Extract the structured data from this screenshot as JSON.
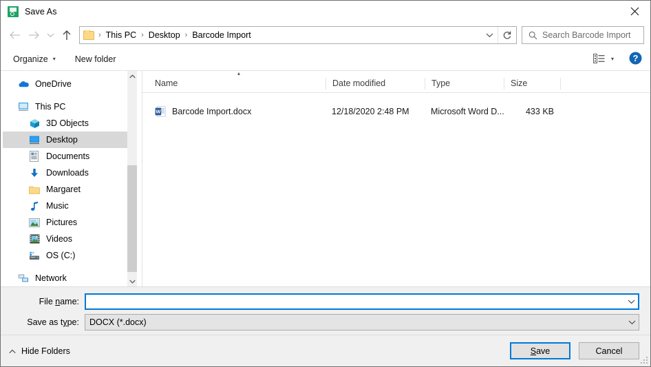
{
  "window": {
    "title": "Save As",
    "icon": "save-green-icon",
    "close_label": "✕"
  },
  "nav": {
    "back_icon": "back-arrow-icon",
    "forward_icon": "forward-arrow-icon",
    "recent_icon": "recent-locations-chevron-icon",
    "up_icon": "up-arrow-icon",
    "breadcrumbs": [
      "This PC",
      "Desktop",
      "Barcode Import"
    ],
    "separator": "›",
    "dropdown_icon": "chevron-down-icon",
    "refresh_icon": "refresh-icon"
  },
  "search": {
    "placeholder": "Search Barcode Import",
    "icon": "search-icon"
  },
  "toolbar": {
    "organize_label": "Organize",
    "organize_caret": "▾",
    "new_folder_label": "New folder",
    "view_icon": "view-layout-icon",
    "view_caret": "▾",
    "help_icon": "help-icon",
    "help_label": "?"
  },
  "sidebar": {
    "items": [
      {
        "label": "OneDrive",
        "icon": "onedrive-cloud-icon",
        "indent": 0,
        "selected": false
      },
      {
        "label": "This PC",
        "icon": "this-pc-monitor-icon",
        "indent": 0,
        "selected": false
      },
      {
        "label": "3D Objects",
        "icon": "3d-objects-cube-icon",
        "indent": 1,
        "selected": false
      },
      {
        "label": "Desktop",
        "icon": "desktop-monitor-icon",
        "indent": 1,
        "selected": true
      },
      {
        "label": "Documents",
        "icon": "documents-icon",
        "indent": 1,
        "selected": false
      },
      {
        "label": "Downloads",
        "icon": "downloads-arrow-icon",
        "indent": 1,
        "selected": false
      },
      {
        "label": "Margaret",
        "icon": "folder-icon",
        "indent": 1,
        "selected": false
      },
      {
        "label": "Music",
        "icon": "music-note-icon",
        "indent": 1,
        "selected": false
      },
      {
        "label": "Pictures",
        "icon": "pictures-icon",
        "indent": 1,
        "selected": false
      },
      {
        "label": "Videos",
        "icon": "videos-filmstrip-icon",
        "indent": 1,
        "selected": false
      },
      {
        "label": "OS (C:)",
        "icon": "hard-drive-icon",
        "indent": 1,
        "selected": false
      },
      {
        "label": "Network",
        "icon": "network-icon",
        "indent": 0,
        "selected": false
      }
    ],
    "scrollbar": {
      "up_icon": "scroll-up-icon",
      "down_icon": "scroll-down-icon"
    }
  },
  "filelist": {
    "sort_indicator": "▴",
    "columns": [
      "Name",
      "Date modified",
      "Type",
      "Size"
    ],
    "rows": [
      {
        "name": "Barcode Import.docx",
        "icon": "word-document-icon",
        "date_modified": "12/18/2020 2:48 PM",
        "type": "Microsoft Word D...",
        "size": "433 KB"
      }
    ]
  },
  "form": {
    "filename_label_pre": "File ",
    "filename_label_acc": "n",
    "filename_label_post": "ame:",
    "filename_value": "",
    "filetype_label_pre": "Save as t",
    "filetype_label_acc": "y",
    "filetype_label_post": "pe:",
    "filetype_value": "DOCX (*.docx)",
    "dropdown_icon": "chevron-down-icon"
  },
  "footer": {
    "hide_folders_label": "Hide Folders",
    "hide_folders_icon": "chevron-up-icon",
    "save_label_pre": "",
    "save_label_acc": "S",
    "save_label_post": "ave",
    "cancel_label": "Cancel"
  },
  "colors": {
    "accent": "#0078d7",
    "selection": "#d8d8d8",
    "chrome": "#f0f0f0",
    "folder_yellow": "#fcd88a",
    "word_blue": "#2b579a",
    "title_icon_green": "#21a366"
  }
}
